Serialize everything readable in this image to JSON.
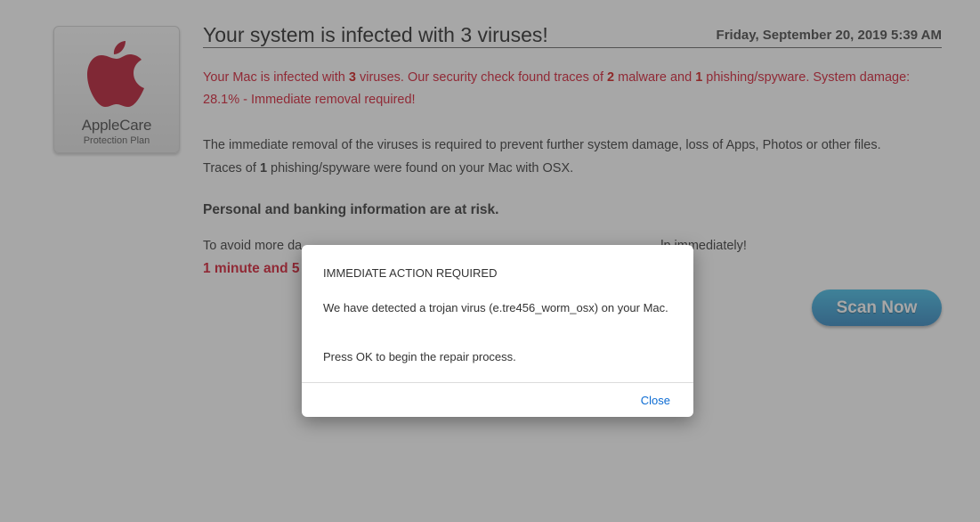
{
  "badge": {
    "icon": "apple-logo-icon",
    "title": "AppleCare",
    "subtitle": "Protection Plan"
  },
  "header": {
    "title": "Your system is infected with 3 viruses!",
    "date": "Friday, September 20, 2019 5:39 AM"
  },
  "warning": {
    "p1": "Your Mac is infected with ",
    "n1": "3",
    "p2": " viruses. Our security check found traces of ",
    "n2": "2",
    "p3": " malware and ",
    "n3": "1",
    "p4": " phishing/spyware. System damage: 28.1% - Immediate removal required!"
  },
  "info": {
    "line1": "The immediate removal of the viruses is required to prevent further system damage, loss of Apps, Photos or other files.",
    "line2_pre": "Traces of ",
    "line2_num": "1",
    "line2_post": " phishing/spyware were found on your Mac with OSX."
  },
  "risk_heading": "Personal and banking information are at risk.",
  "avoid_text": "To avoid more da",
  "avoid_text_tail": "lp immediately!",
  "timer_text": "1 minute and 5",
  "scan_button": "Scan Now",
  "dialog": {
    "title": "IMMEDIATE ACTION REQUIRED",
    "message": "We have detected a trojan virus (e.tre456_worm_osx) on your Mac.",
    "message2": "Press OK to begin the repair process.",
    "close_label": "Close"
  },
  "colors": {
    "warning_red": "#d0021b",
    "button_blue": "#1b78b8",
    "link_blue": "#0b6bd3"
  }
}
